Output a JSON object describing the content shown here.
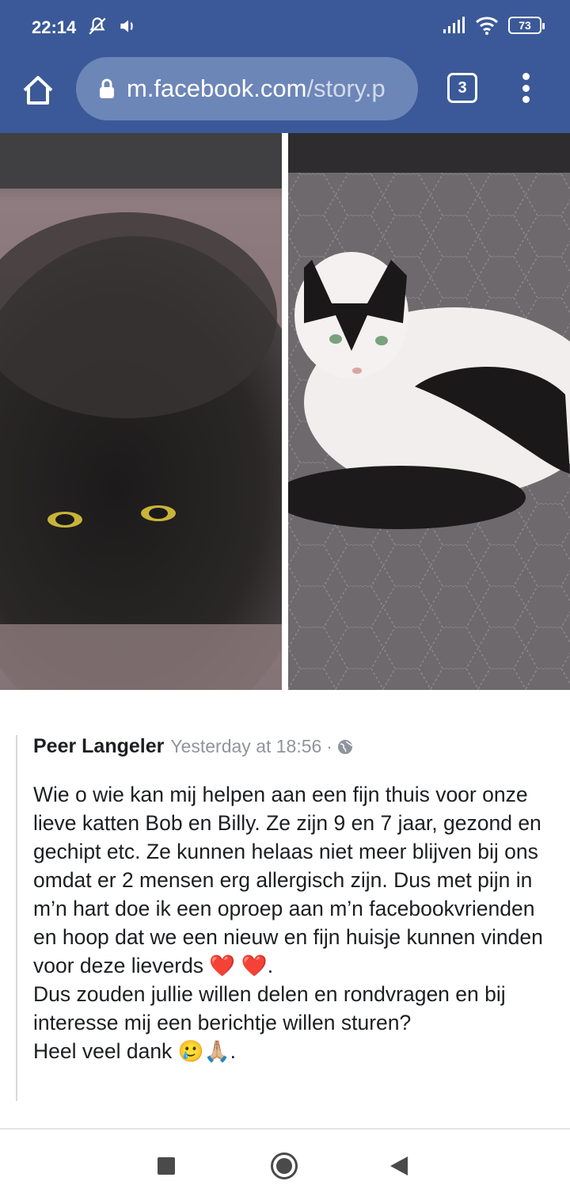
{
  "status_bar": {
    "time": "22:14",
    "battery": "73",
    "icons": [
      "bell-off-icon",
      "volume-icon",
      "signal-icon",
      "wifi-icon",
      "battery-icon"
    ]
  },
  "browser": {
    "url_host": "m.facebook.com",
    "url_path": "/story.p",
    "tab_count": "3",
    "accent": "#3b5998"
  },
  "post": {
    "author": "Peer Langeler",
    "timestamp": "Yesterday at 18:56",
    "separator": "·",
    "body_lines": [
      "Wie o wie kan mij helpen aan een fijn thuis voor onze lieve katten Bob en Billy. Ze zijn 9 en 7 jaar, gezond en gechipt etc. Ze kunnen helaas niet meer blijven bij ons omdat er 2 mensen erg allergisch zijn. Dus met pijn in m’n hart doe ik een oproep aan m’n facebookvrienden en hoop dat we een nieuw en fijn huisje kunnen vinden voor deze lieverds ❤️ ❤️.",
      "Dus zouden jullie willen delen en rondvragen en bij interesse mij een berichtje willen sturen?",
      "Heel veel dank 🥲🙏🏼."
    ]
  },
  "photos": [
    {
      "subject": "black-cat"
    },
    {
      "subject": "black-and-white-cat"
    }
  ]
}
